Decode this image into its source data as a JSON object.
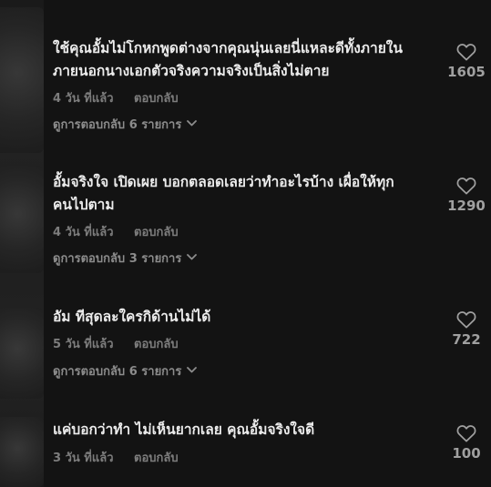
{
  "comments": [
    {
      "text_lines": [
        "ใช้คุณอั้มไม่โกหกพูดต่างจากคุณนุ่นเลยนี่แหละดีทั้งภายใน",
        "ภายนอกนางเอกตัวจริงความจริงเป็นสิ่งไม่ตาย"
      ],
      "time": "4 วัน ที่แล้ว",
      "reply_label": "ตอบกลับ",
      "view_replies": "ดูการตอบกลับ 6 รายการ",
      "likes": "1605"
    },
    {
      "text_lines": [
        "อั้มจริงใจ เปิดเผย บอกตลอดเลยว่าทำอะไรบ้าง เผื่อให้ทุก",
        "คนไปตาม"
      ],
      "time": "4 วัน ที่แล้ว",
      "reply_label": "ตอบกลับ",
      "view_replies": "ดูการตอบกลับ 3 รายการ",
      "likes": "1290"
    },
    {
      "text_lines": [
        "อัม ทีสุดละใครกิด้านไม่ได้"
      ],
      "time": "5 วัน ที่แล้ว",
      "reply_label": "ตอบกลับ",
      "view_replies": "ดูการตอบกลับ 6 รายการ",
      "likes": "722"
    },
    {
      "text_lines": [
        "แค่บอกว่าทำ ไม่เห็นยากเลย คุณอั้มจริงใจดี"
      ],
      "time": "3 วัน ที่แล้ว",
      "reply_label": "ตอบกลับ",
      "likes": "100"
    }
  ],
  "colors": {
    "background": "#131313",
    "text": "#ececec",
    "meta": "#7d7d7d",
    "like_icon": "#a0a0a0"
  },
  "icons": {
    "like": "heart-icon",
    "expand": "chevron-down-icon"
  }
}
